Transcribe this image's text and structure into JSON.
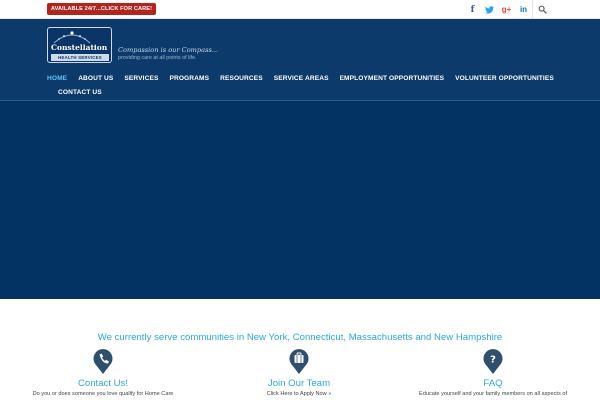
{
  "topbar": {
    "cta_label": "AVAILABLE 24/7...CLICK FOR CARE!",
    "social": [
      {
        "name": "facebook",
        "glyph": "f"
      },
      {
        "name": "twitter",
        "glyph": "t"
      },
      {
        "name": "google-plus",
        "glyph": "g+"
      },
      {
        "name": "linkedin",
        "glyph": "in"
      }
    ]
  },
  "brand": {
    "name": "Constellation",
    "sub": "HEALTH SERVICES",
    "tagline": "Compassion is our Compass...",
    "tagline_sub": "providing care at all points of life."
  },
  "nav": {
    "items": [
      "HOME",
      "ABOUT US",
      "SERVICES",
      "PROGRAMS",
      "RESOURCES",
      "SERVICE AREAS",
      "EMPLOYMENT OPPORTUNITIES",
      "VOLUNTEER OPPORTUNITIES"
    ],
    "second_row": [
      "CONTACT US"
    ],
    "active": "HOME"
  },
  "serve_line": "We currently serve communities in New York, Connecticut, Massachusetts and New Hampshire",
  "features": [
    {
      "title": "Contact Us!",
      "text": "Do you or does someone you love qualify for Home Care",
      "icon": "phone-icon"
    },
    {
      "title": "Join Our Team",
      "text": "Click Here to Apply Now »",
      "icon": "briefcase-icon"
    },
    {
      "title": "FAQ",
      "text": "Educate yourself and your family members on all aspects of",
      "icon": "question-icon"
    }
  ],
  "colors": {
    "header": "#0b3a6b",
    "hero": "#023363",
    "accent": "#2da7d8",
    "cta": "#b3241f",
    "active_nav": "#5ec4ef"
  }
}
